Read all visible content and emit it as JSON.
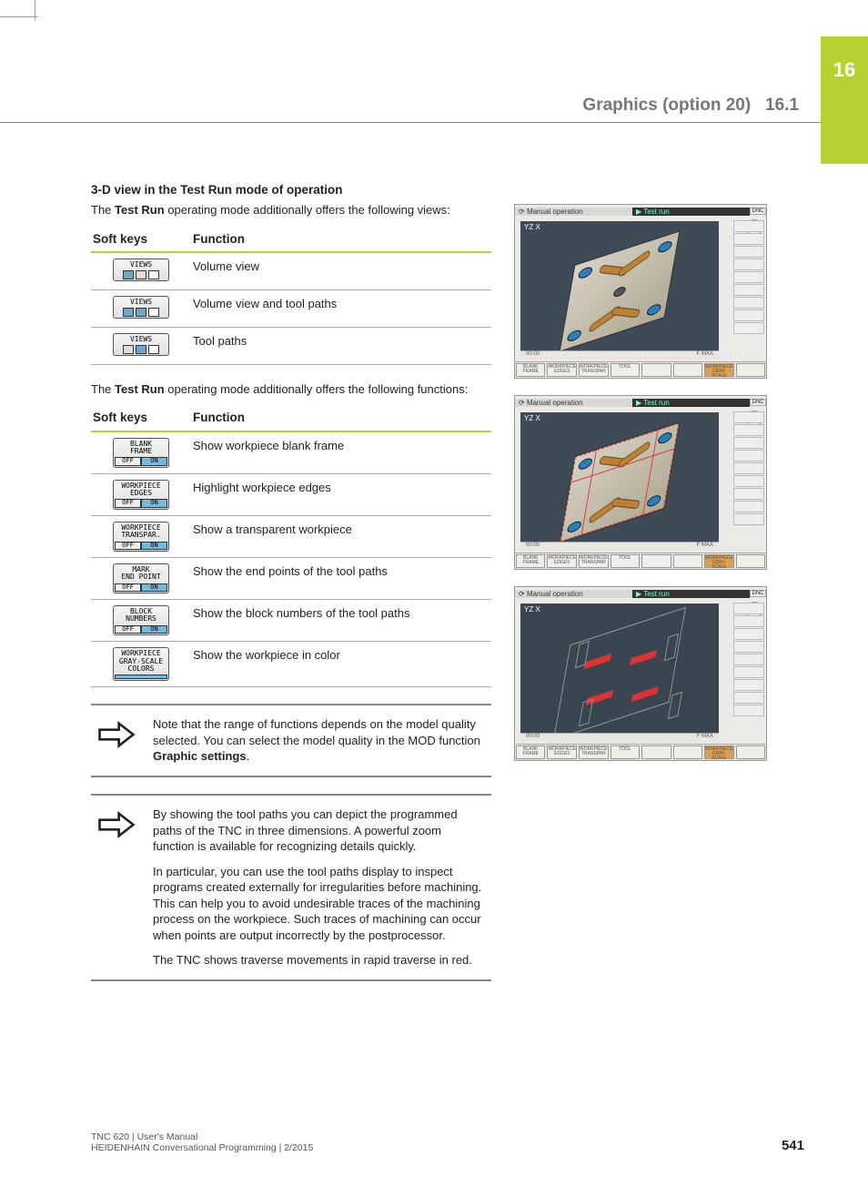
{
  "chapter_num": "16",
  "header_title": "Graphics (option 20)",
  "header_section": "16.1",
  "h4": "3-D view in the Test Run mode of operation",
  "intro1_pre": "The ",
  "intro1_bold": "Test Run",
  "intro1_post": " operating mode additionally offers the following views:",
  "intro2_pre": "The ",
  "intro2_bold": "Test Run",
  "intro2_post": " operating mode additionally offers the following functions:",
  "col_softkeys": "Soft keys",
  "col_function": "Function",
  "views": [
    {
      "label": "VIEWS",
      "func": "Volume view"
    },
    {
      "label": "VIEWS",
      "func": "Volume view and tool paths"
    },
    {
      "label": "VIEWS",
      "func": "Tool paths"
    }
  ],
  "functions": [
    {
      "label": "BLANK\nFRAME",
      "off": "OFF",
      "on": "ON",
      "func": "Show workpiece blank frame"
    },
    {
      "label": "WORKPIECE\nEDGES",
      "off": "OFF",
      "on": "ON",
      "func": "Highlight workpiece edges"
    },
    {
      "label": "WORKPIECE\nTRANSPAR.",
      "off": "OFF",
      "on": "ON",
      "func": "Show a transparent workpiece"
    },
    {
      "label": "MARK\nEND POINT",
      "off": "OFF",
      "on": "ON",
      "func": "Show the end points of the tool paths"
    },
    {
      "label": "BLOCK\nNUMBERS",
      "off": "OFF",
      "on": "ON",
      "func": "Show the block numbers of the tool paths"
    },
    {
      "label": "WORKPIECE\nGRAY-SCALE\nCOLORS",
      "func": "Show the workpiece in color"
    }
  ],
  "note1_pre": "Note that the range of functions depends on the model quality selected. You can select the model quality in the MOD function ",
  "note1_bold": "Graphic settings",
  "note1_post": ".",
  "note2_p1": "By showing the tool paths you can depict the programmed paths of the TNC in three dimensions. A powerful zoom function is available for recognizing details quickly.",
  "note2_p2": "In particular, you can use the tool paths display to inspect programs created externally for irregularities before machining. This can help you to avoid undesirable traces of the machining process on the workpiece. Such traces of machining can occur when points are output incorrectly by the postprocessor.",
  "note2_p3": "The TNC shows traverse movements in rapid traverse in red.",
  "screens": {
    "mode_left": "Manual operation",
    "mode_right": "Test run",
    "dnc": "DNC",
    "axis": "YZ  X",
    "status_left": "00:00",
    "status_right": "F MAX",
    "bbar": [
      "BLANK FRAME",
      "WORKPIECE EDGES",
      "WORKPIECE TRANSPAR",
      "TOOL",
      "",
      "",
      "WORKPIECE GRAY-SCALE COLORS",
      ""
    ]
  },
  "footer_line1": "TNC 620 | User's Manual",
  "footer_line2": "HEIDENHAIN Conversational Programming | 2/2015",
  "page_num": "541"
}
